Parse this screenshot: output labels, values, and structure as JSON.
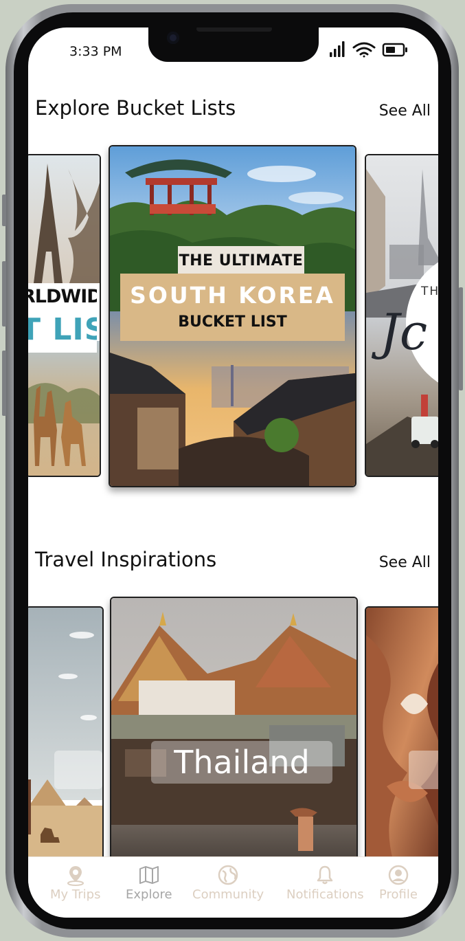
{
  "status_bar": {
    "time": "3:33 PM"
  },
  "sections": {
    "bucket_lists": {
      "title": "Explore Bucket Lists",
      "see_all": "See All"
    },
    "inspirations": {
      "title": "Travel Inspirations",
      "see_all": "See All"
    }
  },
  "bucket_cards": {
    "left": {
      "line1": "RLDWIDE",
      "line2": "T LIST"
    },
    "center": {
      "top": "THE ULTIMATE",
      "main": "SOUTH KOREA",
      "sub": "BUCKET LIST"
    },
    "right": {
      "line1": "TH",
      "script": "Jc"
    }
  },
  "inspiration_cards": {
    "center": {
      "label": "Thailand"
    }
  },
  "nav": {
    "items": [
      {
        "label": "My Trips",
        "icon": "map-pin-icon"
      },
      {
        "label": "Explore",
        "icon": "map-icon"
      },
      {
        "label": "Community",
        "icon": "globe-icon"
      },
      {
        "label": "Notifications",
        "icon": "bell-icon"
      },
      {
        "label": "Profile",
        "icon": "profile-icon"
      }
    ]
  },
  "colors": {
    "accent": "#d9b887",
    "nav_inactive": "#dccfc1",
    "nav_active": "#a6a6a6",
    "bucket_teal": "#3fa3b8"
  }
}
